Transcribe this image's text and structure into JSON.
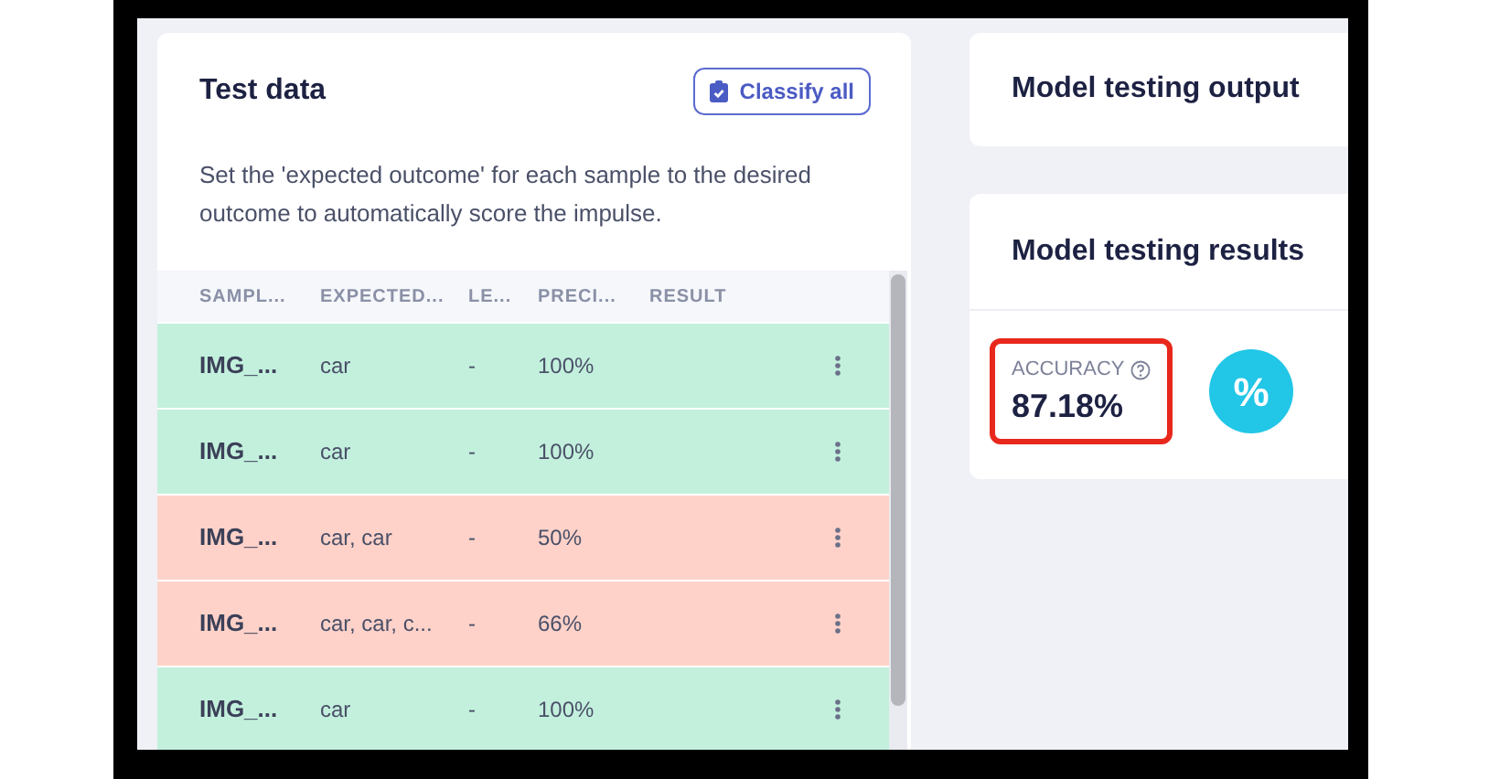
{
  "test_data": {
    "title": "Test data",
    "classify_button": "Classify all",
    "description": "Set the 'expected outcome' for each sample to the desired outcome to automatically score the impulse.",
    "table": {
      "columns": [
        "SAMPL...",
        "EXPECTED...",
        "LE...",
        "PRECI...",
        "RESULT"
      ],
      "rows": [
        {
          "sample": "IMG_...",
          "expected": "car",
          "length": "-",
          "precision": "100%",
          "correct": true
        },
        {
          "sample": "IMG_...",
          "expected": "car",
          "length": "-",
          "precision": "100%",
          "correct": true
        },
        {
          "sample": "IMG_...",
          "expected": "car, car",
          "length": "-",
          "precision": "50%",
          "correct": false
        },
        {
          "sample": "IMG_...",
          "expected": "car, car, c...",
          "length": "-",
          "precision": "66%",
          "correct": false
        },
        {
          "sample": "IMG_...",
          "expected": "car",
          "length": "-",
          "precision": "100%",
          "correct": true
        }
      ]
    }
  },
  "output_card": {
    "title": "Model testing output"
  },
  "results_card": {
    "title": "Model testing results",
    "accuracy": {
      "label": "ACCURACY",
      "value": "87.18%",
      "highlighted": true
    },
    "badge": "%"
  }
}
